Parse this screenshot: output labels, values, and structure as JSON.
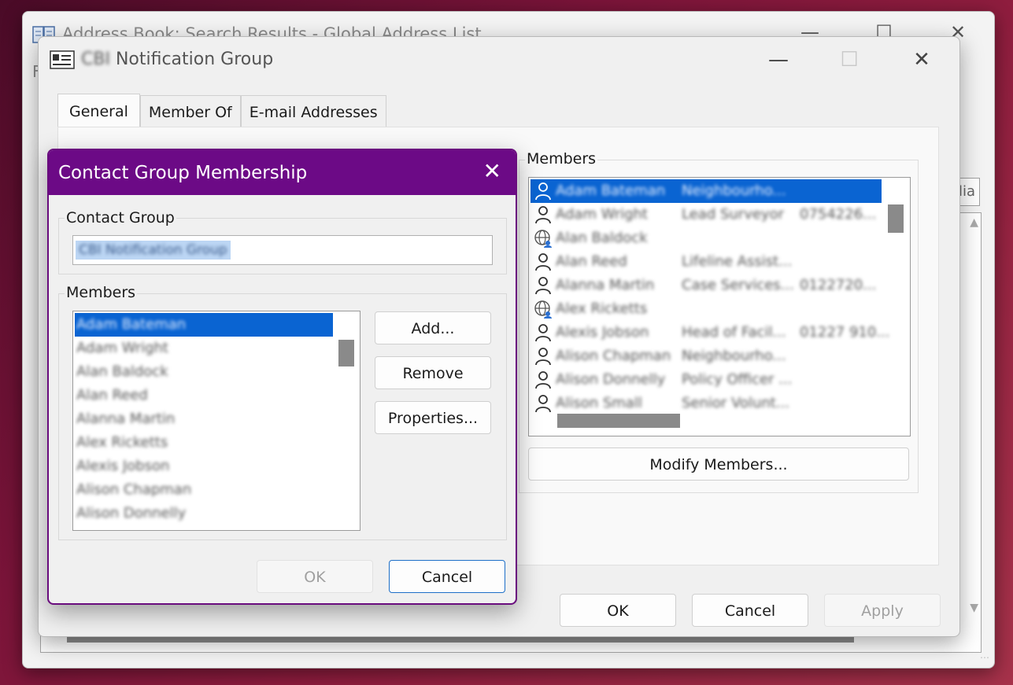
{
  "address_book": {
    "title": "Address Book: Search Results - Global Address List",
    "menu_letter": "F",
    "search_fragment": "lia"
  },
  "notification_group": {
    "title": "Notification Group",
    "title_prefix_blurred": "CBI",
    "tabs": [
      {
        "label": "General",
        "active": true
      },
      {
        "label": "Member Of",
        "active": false
      },
      {
        "label": "E-mail Addresses",
        "active": false
      }
    ],
    "members_label": "Members",
    "members": [
      {
        "name": "Adam Bateman",
        "title": "Neighbourho...",
        "phone": "",
        "icon": "person-icon",
        "selected": true
      },
      {
        "name": "Adam Wright",
        "title": "Lead Surveyor",
        "phone": "0754226...",
        "icon": "person-icon"
      },
      {
        "name": "Alan Baldock",
        "title": "",
        "phone": "",
        "icon": "globe-contact-icon"
      },
      {
        "name": "Alan Reed",
        "title": "Lifeline Assist...",
        "phone": "",
        "icon": "person-icon"
      },
      {
        "name": "Alanna Martin",
        "title": "Case Services...",
        "phone": "0122720...",
        "icon": "person-icon"
      },
      {
        "name": "Alex Ricketts",
        "title": "",
        "phone": "",
        "icon": "globe-contact-icon"
      },
      {
        "name": "Alexis Jobson",
        "title": "Head of Facil...",
        "phone": "01227 910...",
        "icon": "person-icon"
      },
      {
        "name": "Alison Chapman",
        "title": "Neighbourho...",
        "phone": "",
        "icon": "person-icon"
      },
      {
        "name": "Alison Donnelly",
        "title": "Policy Officer ...",
        "phone": "",
        "icon": "person-icon"
      },
      {
        "name": "Alison Small",
        "title": "Senior Volunt...",
        "phone": "",
        "icon": "person-icon"
      }
    ],
    "modify_members_label": "Modify Members...",
    "ok_label": "OK",
    "cancel_label": "Cancel",
    "apply_label": "Apply"
  },
  "contact_group_dialog": {
    "title": "Contact Group Membership",
    "contact_group_label": "Contact Group",
    "contact_group_value": "CBI Notification Group",
    "members_label": "Members",
    "members": [
      {
        "name": "Adam Bateman",
        "selected": true
      },
      {
        "name": "Adam Wright"
      },
      {
        "name": "Alan Baldock"
      },
      {
        "name": "Alan Reed"
      },
      {
        "name": "Alanna Martin"
      },
      {
        "name": "Alex Ricketts"
      },
      {
        "name": "Alexis Jobson"
      },
      {
        "name": "Alison Chapman"
      },
      {
        "name": "Alison Donnelly"
      }
    ],
    "add_label": "Add...",
    "remove_label": "Remove",
    "properties_label": "Properties...",
    "ok_label": "OK",
    "cancel_label": "Cancel"
  },
  "colors": {
    "dialog_titlebar": "#6c0a86",
    "selection": "#0a64d2",
    "default_button_border": "#1d6fc8"
  }
}
